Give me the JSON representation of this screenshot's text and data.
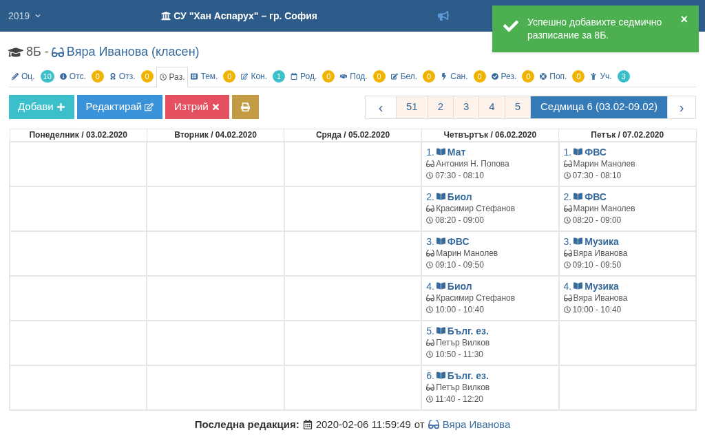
{
  "header": {
    "year": "2019",
    "school": "СУ \"Хан Аспарух\" – гр. София"
  },
  "toast": {
    "message": "Успешно добавихте седмично разписание за 8Б.",
    "close": "×"
  },
  "class_title": {
    "class": "8Б -",
    "teacher": "Вяра Иванова (класен)"
  },
  "tabs": [
    {
      "label": "Оц.",
      "count": "10",
      "color": "#3bbfca",
      "selected": false
    },
    {
      "label": "Отс.",
      "count": "0",
      "color": "#f0b400",
      "selected": false
    },
    {
      "label": "Отз.",
      "count": "0",
      "color": "#f0b400",
      "selected": false
    },
    {
      "label": "Раз.",
      "selected": true
    },
    {
      "label": "Тем.",
      "count": "0",
      "color": "#f0b400",
      "selected": false
    },
    {
      "label": "Кон.",
      "count": "1",
      "color": "#3bbfca",
      "selected": false
    },
    {
      "label": "Род.",
      "count": "0",
      "color": "#f0b400",
      "selected": false
    },
    {
      "label": "Под.",
      "count": "0",
      "color": "#f0b400",
      "selected": false
    },
    {
      "label": "Бел.",
      "count": "0",
      "color": "#f0b400",
      "selected": false
    },
    {
      "label": "Сан.",
      "count": "0",
      "color": "#f0b400",
      "selected": false
    },
    {
      "label": "Рез.",
      "count": "0",
      "color": "#f0b400",
      "selected": false
    },
    {
      "label": "Поп.",
      "count": "0",
      "color": "#f0b400",
      "selected": false
    },
    {
      "label": "Уч.",
      "count": "3",
      "color": "#3bbfca",
      "selected": false
    }
  ],
  "actions": [
    {
      "kind": "add",
      "label": "Добави"
    },
    {
      "kind": "edit",
      "label": "Редактирай"
    },
    {
      "kind": "delete",
      "label": "Изтрий"
    },
    {
      "kind": "print"
    }
  ],
  "pagination": {
    "prev": "‹",
    "pages": [
      {
        "label": "51",
        "selected": false
      },
      {
        "label": "2",
        "selected": false
      },
      {
        "label": "3",
        "selected": false
      },
      {
        "label": "4",
        "selected": false
      },
      {
        "label": "5",
        "selected": false
      },
      {
        "label": "Седмица 6 (03.02-09.02)",
        "selected": true
      }
    ],
    "next": "›"
  },
  "table": {
    "columns": [
      "Понеделник / 03.02.2020",
      "Вторник / 04.02.2020",
      "Сряда / 05.02.2020",
      "Четвъртък / 06.02.2020",
      "Петък / 07.02.2020"
    ],
    "rows": [
      [
        null,
        null,
        null,
        {
          "number": "1.",
          "subject": "Мат",
          "teacher": "Антония Н. Попова",
          "time": "07:30 - 08:10"
        },
        {
          "number": "1.",
          "subject": "ФВС",
          "teacher": "Марин Манолев",
          "time": "07:30 - 08:10"
        }
      ],
      [
        null,
        null,
        null,
        {
          "number": "2.",
          "subject": "Биол",
          "teacher": "Красимир Стефанов",
          "time": "08:20 - 09:00"
        },
        {
          "number": "2.",
          "subject": "ФВС",
          "teacher": "Марин Манолев",
          "time": "08:20 - 09:00"
        }
      ],
      [
        null,
        null,
        null,
        {
          "number": "3.",
          "subject": "ФВС",
          "teacher": "Марин Манолев",
          "time": "09:10 - 09:50"
        },
        {
          "number": "3.",
          "subject": "Музика",
          "teacher": "Вяра Иванова",
          "time": "09:10 - 09:50"
        }
      ],
      [
        null,
        null,
        null,
        {
          "number": "4.",
          "subject": "Биол",
          "teacher": "Красимир Стефанов",
          "time": "10:00 - 10:40"
        },
        {
          "number": "4.",
          "subject": "Музика",
          "teacher": "Вяра Иванова",
          "time": "10:00 - 10:40"
        }
      ],
      [
        null,
        null,
        null,
        {
          "number": "5.",
          "subject": "Бълг. ез.",
          "teacher": "Петър Вилков",
          "time": "10:50 - 11:30"
        },
        null
      ],
      [
        null,
        null,
        null,
        {
          "number": "6.",
          "subject": "Бълг. ез.",
          "teacher": "Петър Вилков",
          "time": "11:40 - 12:20"
        },
        null
      ]
    ]
  },
  "footer": {
    "label": "Последна редакция:",
    "timestamp": "2020-02-06 11:59:49",
    "by": "от",
    "editor": "Вяра Иванова"
  }
}
